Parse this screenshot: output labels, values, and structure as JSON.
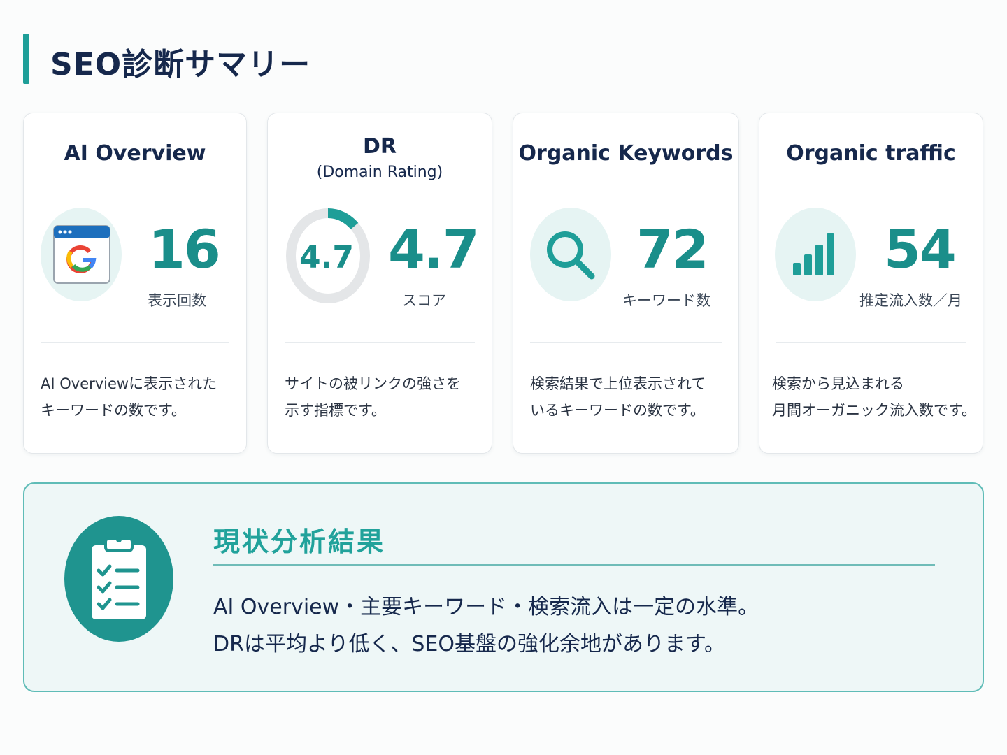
{
  "page": {
    "title": "SEO診断サマリー"
  },
  "cards": [
    {
      "title": "AI Overview",
      "icon": "google-browser-icon",
      "value": "16",
      "label": "表示回数",
      "desc_lines": [
        "AI Overviewに表示された",
        "キーワードの数です。"
      ]
    },
    {
      "title": "DR",
      "subtitle": "(Domain Rating)",
      "icon": "donut-gauge-icon",
      "gauge_value": "4.7",
      "gauge_fraction": 0.047,
      "value": "4.7",
      "label": "スコア",
      "desc_lines": [
        "サイトの被リンクの強さを",
        "示す指標です。"
      ]
    },
    {
      "title": "Organic Keywords",
      "icon": "search-icon",
      "value": "72",
      "label": "キーワード数",
      "desc_lines": [
        "検索結果で上位表示されて",
        "いるキーワードの数です。"
      ]
    },
    {
      "title": "Organic traffic",
      "icon": "bar-chart-icon",
      "value": "54",
      "label": "推定流入数／月",
      "desc_lines": [
        "検索から見込まれる",
        "月間オーガニック流入数です。"
      ]
    }
  ],
  "result": {
    "icon": "clipboard-checklist-icon",
    "title": "現状分析結果",
    "lines": [
      "AI Overview・主要キーワード・検索流入は一定の水準。",
      "DRは平均より低く、SEO基盤の強化余地があります。"
    ]
  },
  "colors": {
    "accent": "#1e9e98",
    "title_text": "#16284c",
    "value_text": "#1a8e8a",
    "panel_bg": "#eef7f7",
    "panel_border": "#5fbcb7"
  }
}
